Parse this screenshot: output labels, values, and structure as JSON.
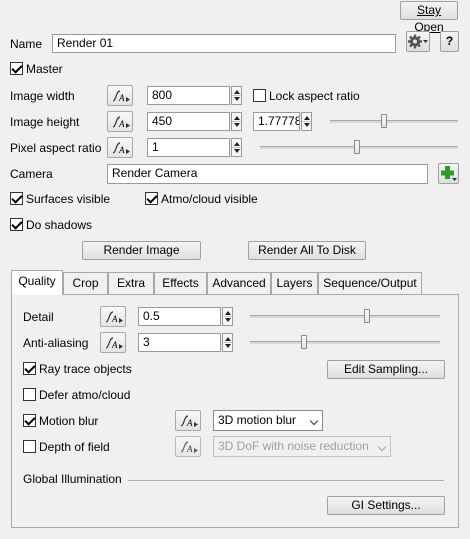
{
  "top": {
    "stay_open": "Stay Open"
  },
  "name_row": {
    "label": "Name",
    "value": "Render 01",
    "help": "?"
  },
  "master": {
    "label": "Master",
    "checked": true
  },
  "image_width": {
    "label": "Image width",
    "value": "800",
    "lock_label": "Lock aspect ratio"
  },
  "image_height": {
    "label": "Image height",
    "value": "450",
    "ratio": "1.77778"
  },
  "pixel_aspect": {
    "label": "Pixel aspect ratio",
    "value": "1"
  },
  "camera": {
    "label": "Camera",
    "value": "Render Camera"
  },
  "surfaces_visible": {
    "label": "Surfaces visible"
  },
  "atmo_visible": {
    "label": "Atmo/cloud visible"
  },
  "do_shadows": {
    "label": "Do shadows"
  },
  "actions": {
    "render_image": "Render Image",
    "render_all": "Render All To Disk"
  },
  "tabs": [
    "Quality",
    "Crop",
    "Extra",
    "Effects",
    "Advanced",
    "Layers",
    "Sequence/Output"
  ],
  "quality": {
    "detail_label": "Detail",
    "detail_value": "0.5",
    "aa_label": "Anti-aliasing",
    "aa_value": "3",
    "ray_trace": "Ray trace objects",
    "edit_sampling": "Edit Sampling...",
    "defer_atmo": "Defer atmo/cloud",
    "motion_blur": "Motion blur",
    "motion_blur_mode": "3D motion blur",
    "dof": "Depth of field",
    "dof_mode": "3D DoF with noise reduction",
    "gi_label": "Global Illumination",
    "gi_settings": "GI Settings..."
  },
  "icons": {
    "anim": "animation-curve-icon",
    "gear": "gear-icon",
    "add": "add-green-plus-icon"
  }
}
